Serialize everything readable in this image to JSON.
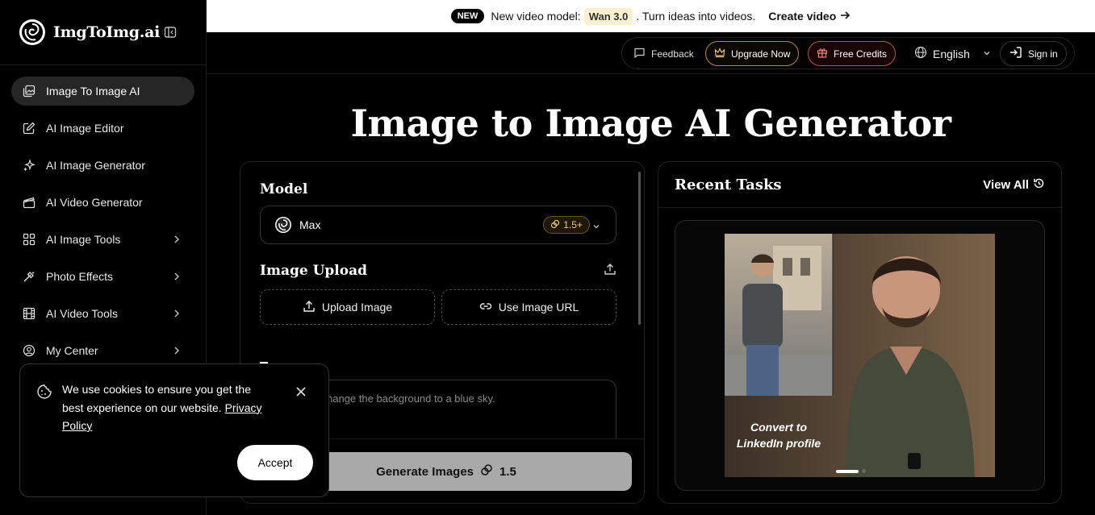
{
  "brand": {
    "name": "ImgToImg.ai"
  },
  "sidebar": {
    "items": [
      {
        "label": "Image To Image AI",
        "icon": "images-icon",
        "active": true,
        "chevron": false
      },
      {
        "label": "AI Image Editor",
        "icon": "edit-icon",
        "active": false,
        "chevron": false
      },
      {
        "label": "AI Image Generator",
        "icon": "sparkles-icon",
        "active": false,
        "chevron": false
      },
      {
        "label": "AI Video Generator",
        "icon": "clapperboard-icon",
        "active": false,
        "chevron": false
      },
      {
        "label": "AI Image Tools",
        "icon": "grid-icon",
        "active": false,
        "chevron": true
      },
      {
        "label": "Photo Effects",
        "icon": "wand-icon",
        "active": false,
        "chevron": true
      },
      {
        "label": "AI Video Tools",
        "icon": "film-icon",
        "active": false,
        "chevron": true
      },
      {
        "label": "My Center",
        "icon": "user-circle-icon",
        "active": false,
        "chevron": true
      }
    ]
  },
  "banner": {
    "badge": "NEW",
    "text_before": "New video model:",
    "model": "Wan 3.0",
    "text_after": ". Turn ideas into videos.",
    "cta": "Create video"
  },
  "topbar": {
    "feedback": "Feedback",
    "upgrade": "Upgrade Now",
    "credits": "Free Credits",
    "language": "English",
    "signin": "Sign in"
  },
  "main": {
    "title": "Image to Image AI Generator",
    "model_label": "Model",
    "model_value": "Max",
    "model_cost": "1.5+",
    "upload_label": "Image Upload",
    "upload_button": "Upload Image",
    "url_button": "Use Image URL",
    "prompt_placeholder": "hange the background to a blue sky.",
    "generate_label": "Generate Images",
    "generate_cost": "1.5"
  },
  "recent": {
    "title": "Recent Tasks",
    "view_all": "View All",
    "caption_line1": "Convert to",
    "caption_line2": "LinkedIn profile"
  },
  "cookie": {
    "text": "We use cookies to ensure you get the best experience on our website.",
    "link": "Privacy Policy",
    "accept": "Accept"
  },
  "colors": {
    "accent_gold": "#b48a3b",
    "accent_red": "#c4474b",
    "generate_bg": "#a9a9a9"
  }
}
